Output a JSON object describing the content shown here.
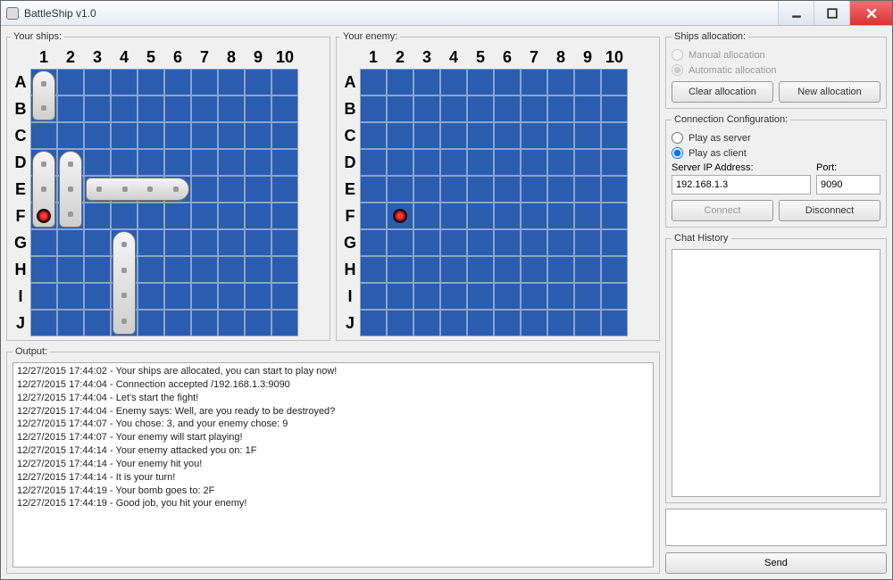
{
  "window_title": "BattleShip v1.0",
  "labels": {
    "your_ships": "Your ships:",
    "your_enemy": "Your enemy:",
    "output": "Output:",
    "ships_alloc": "Ships allocation:",
    "manual": "Manual allocation",
    "auto": "Automatic allocation",
    "clear": "Clear allocation",
    "new": "New allocation",
    "conn_conf": "Connection Configuration:",
    "play_server": "Play as server",
    "play_client": "Play as client",
    "server_ip": "Server IP Address:",
    "port": "Port:",
    "connect": "Connect",
    "disconnect": "Disconnect",
    "chat_history": "Chat History",
    "send": "Send"
  },
  "connection": {
    "ip": "192.168.1.3",
    "port": "9090",
    "mode": "client"
  },
  "grid": {
    "cols": [
      "1",
      "2",
      "3",
      "4",
      "5",
      "6",
      "7",
      "8",
      "9",
      "10"
    ],
    "rows": [
      "A",
      "B",
      "C",
      "D",
      "E",
      "F",
      "G",
      "H",
      "I",
      "J"
    ]
  },
  "your_ships": [
    {
      "row": 0,
      "col": 0,
      "len": 2,
      "orient": "v"
    },
    {
      "row": 3,
      "col": 0,
      "len": 3,
      "orient": "v"
    },
    {
      "row": 3,
      "col": 1,
      "len": 3,
      "orient": "v"
    },
    {
      "row": 4,
      "col": 2,
      "len": 4,
      "orient": "h"
    },
    {
      "row": 6,
      "col": 3,
      "len": 4,
      "orient": "v"
    }
  ],
  "your_hits": [
    {
      "row": 5,
      "col": 0
    }
  ],
  "enemy_hits": [
    {
      "row": 5,
      "col": 1
    }
  ],
  "output_lines": [
    "12/27/2015 17:44:02 - Your ships are allocated, you can start to play now!",
    "12/27/2015 17:44:04 - Connection accepted /192.168.1.3:9090",
    "12/27/2015 17:44:04 - Let's start the fight!",
    "12/27/2015 17:44:04 - Enemy says: Well, are you ready to be destroyed?",
    "12/27/2015 17:44:07 - You chose: 3, and your enemy chose: 9",
    "12/27/2015 17:44:07 - Your enemy will start playing!",
    "12/27/2015 17:44:14 - Your enemy attacked you on: 1F",
    "12/27/2015 17:44:14 - Your enemy hit you!",
    "12/27/2015 17:44:14 - It is your turn!",
    "12/27/2015 17:44:19 - Your bomb goes to: 2F",
    "12/27/2015 17:44:19 - Good job, you hit your enemy!"
  ]
}
